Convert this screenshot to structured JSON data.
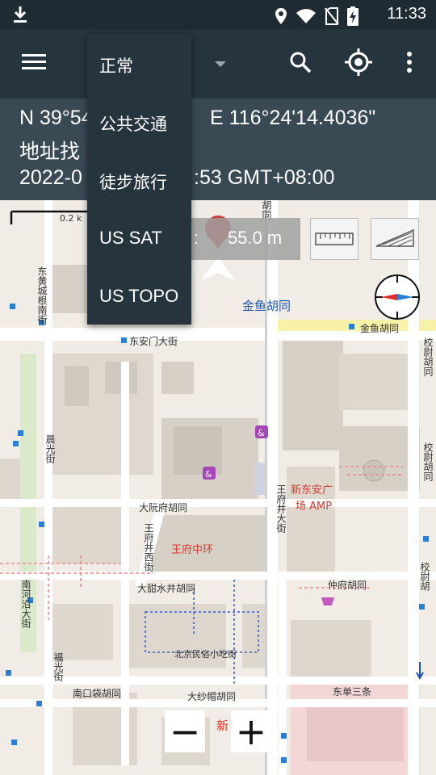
{
  "status_bar": {
    "time": "11:33"
  },
  "map_type_menu": {
    "items": [
      "正常",
      "公共交通",
      "徒步旅行",
      "US SAT",
      "US TOPO"
    ]
  },
  "coordinates": {
    "row1_left": "N 39°54",
    "row1_right": "E 116°24'14.4036\"",
    "row2": "地址找",
    "row3_left": "2022-0",
    "row3_right": ":53 GMT+08:00"
  },
  "measure": {
    "sep": ":",
    "value": "55.0 m"
  },
  "scale": {
    "label": "0.2 k"
  },
  "zoom": {
    "minus": "−",
    "plus": "+"
  },
  "map_labels": {
    "jinyu_hutong": "金鱼胡同",
    "jinyu_hutong_road": "金鱼胡同",
    "dongandamen": "东安门大街",
    "dayuanfu": "大阮府胡同",
    "wangfujing_jie": "王府井大街",
    "wangfu_zhonghuan": "王府中环",
    "xindongan": "新东安广",
    "xindongan_amp": "场 AMP",
    "datianshui": "大甜水井胡同",
    "zhongfu": "仲府胡同",
    "beijing_snack": "北京民俗小吃街",
    "nankoudai": "南口袋胡同",
    "dashami": "大纱帽胡同",
    "dongdan": "东单三条",
    "xiaojiao": "校尉胡同",
    "xiaojiao2": "校尉胡同",
    "jiaoweijie": "校尉胡",
    "nanhe": "南河沿大街",
    "huangcheng": "皇城根南街",
    "chenguang": "晨光街",
    "fuguang": "福光街",
    "wangfujingxi": "王府井西街",
    "xin_mall": "新",
    "xin_mall2": "场",
    "donghuang": "东黄城根南街",
    "lane1": "胡同"
  }
}
